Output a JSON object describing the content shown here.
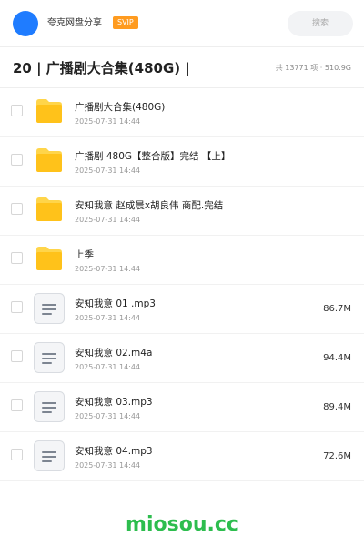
{
  "header": {
    "user_name": "夸克网盘分享",
    "badge": "SVIP",
    "search_placeholder": "搜索"
  },
  "title_bar": {
    "title": "20 | 广播剧大合集(480G) |",
    "summary": "共 13771 项 · 510.9G"
  },
  "files": [
    {
      "type": "folder",
      "name": "广播剧大合集(480G)",
      "date": "2025-07-31 14:44",
      "size": ""
    },
    {
      "type": "folder",
      "name": "广播剧 480G【整合版】完结 【上】",
      "date": "2025-07-31 14:44",
      "size": ""
    },
    {
      "type": "folder",
      "name": "安知我意 赵成晨x胡良伟 商配.完结",
      "date": "2025-07-31 14:44",
      "size": ""
    },
    {
      "type": "folder",
      "name": "上季",
      "date": "2025-07-31 14:44",
      "size": ""
    },
    {
      "type": "file",
      "name": "安知我意 01 .mp3",
      "date": "2025-07-31 14:44",
      "size": "86.7M"
    },
    {
      "type": "file",
      "name": "安知我意 02.m4a",
      "date": "2025-07-31 14:44",
      "size": "94.4M"
    },
    {
      "type": "file",
      "name": "安知我意 03.mp3",
      "date": "2025-07-31 14:44",
      "size": "89.4M"
    },
    {
      "type": "file",
      "name": "安知我意 04.mp3",
      "date": "2025-07-31 14:44",
      "size": "72.6M"
    }
  ],
  "watermark": "miosou.cc",
  "colors": {
    "avatar": "#1f7cff",
    "badge": "#ff9b1f",
    "folder": "#ffc21a",
    "watermark": "#2dbd4e"
  },
  "icons": {
    "folder": "folder-icon",
    "file": "document-icon"
  }
}
